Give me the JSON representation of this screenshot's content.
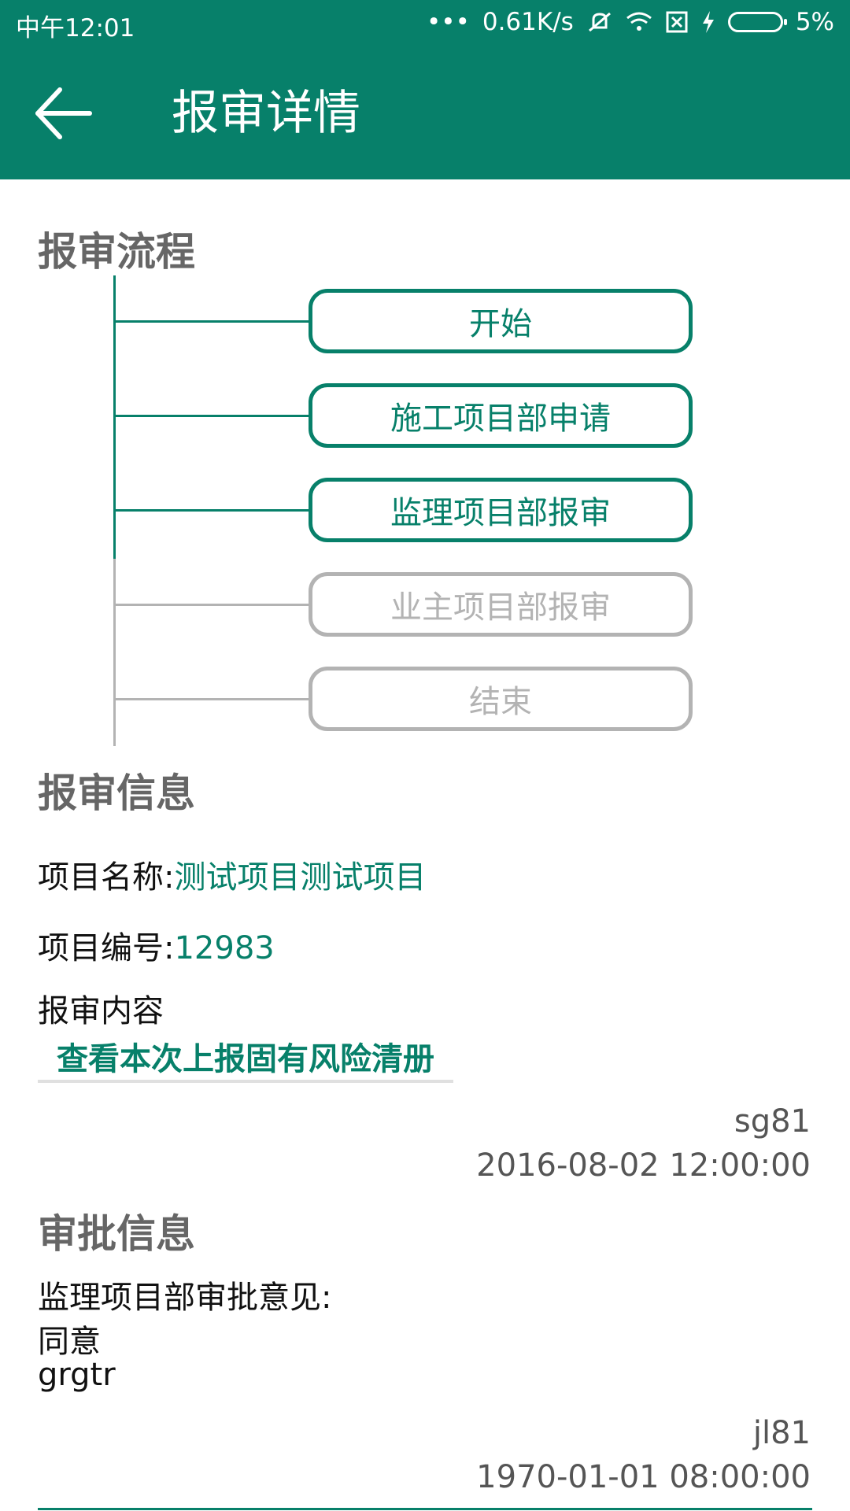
{
  "status_bar": {
    "time": "中午12:01",
    "dots": "•••",
    "network_speed": "0.61K/s",
    "battery_percent": "5%",
    "icons": [
      "mute-icon",
      "wifi-icon",
      "sim-off-icon",
      "charging-icon",
      "battery-icon"
    ]
  },
  "app_bar": {
    "title": "报审详情",
    "back_icon": "arrow-left-icon"
  },
  "flow": {
    "title": "报审流程",
    "steps": [
      {
        "label": "开始",
        "active": true
      },
      {
        "label": "施工项目部申请",
        "active": true
      },
      {
        "label": "监理项目部报审",
        "active": true
      },
      {
        "label": "业主项目部报审",
        "active": false
      },
      {
        "label": "结束",
        "active": false
      }
    ]
  },
  "info": {
    "title": "报审信息",
    "project_name_label": "项目名称:",
    "project_name": "测试项目测试项目",
    "project_no_label": "项目编号:",
    "project_no": "12983",
    "content_label": "报审内容",
    "content_link": "查看本次上报固有风险清册",
    "submitter": "sg81",
    "submit_time": "2016-08-02 12:00:00"
  },
  "approval": {
    "title": "审批信息",
    "opinion_label": "监理项目部审批意见:",
    "opinion_lines": [
      "同意",
      "grgtr"
    ],
    "approver": "jl81",
    "approve_time": "1970-01-01 08:00:00"
  },
  "colors": {
    "primary": "#07806a",
    "inactive": "#b3b3b3",
    "section_title": "#666666"
  }
}
